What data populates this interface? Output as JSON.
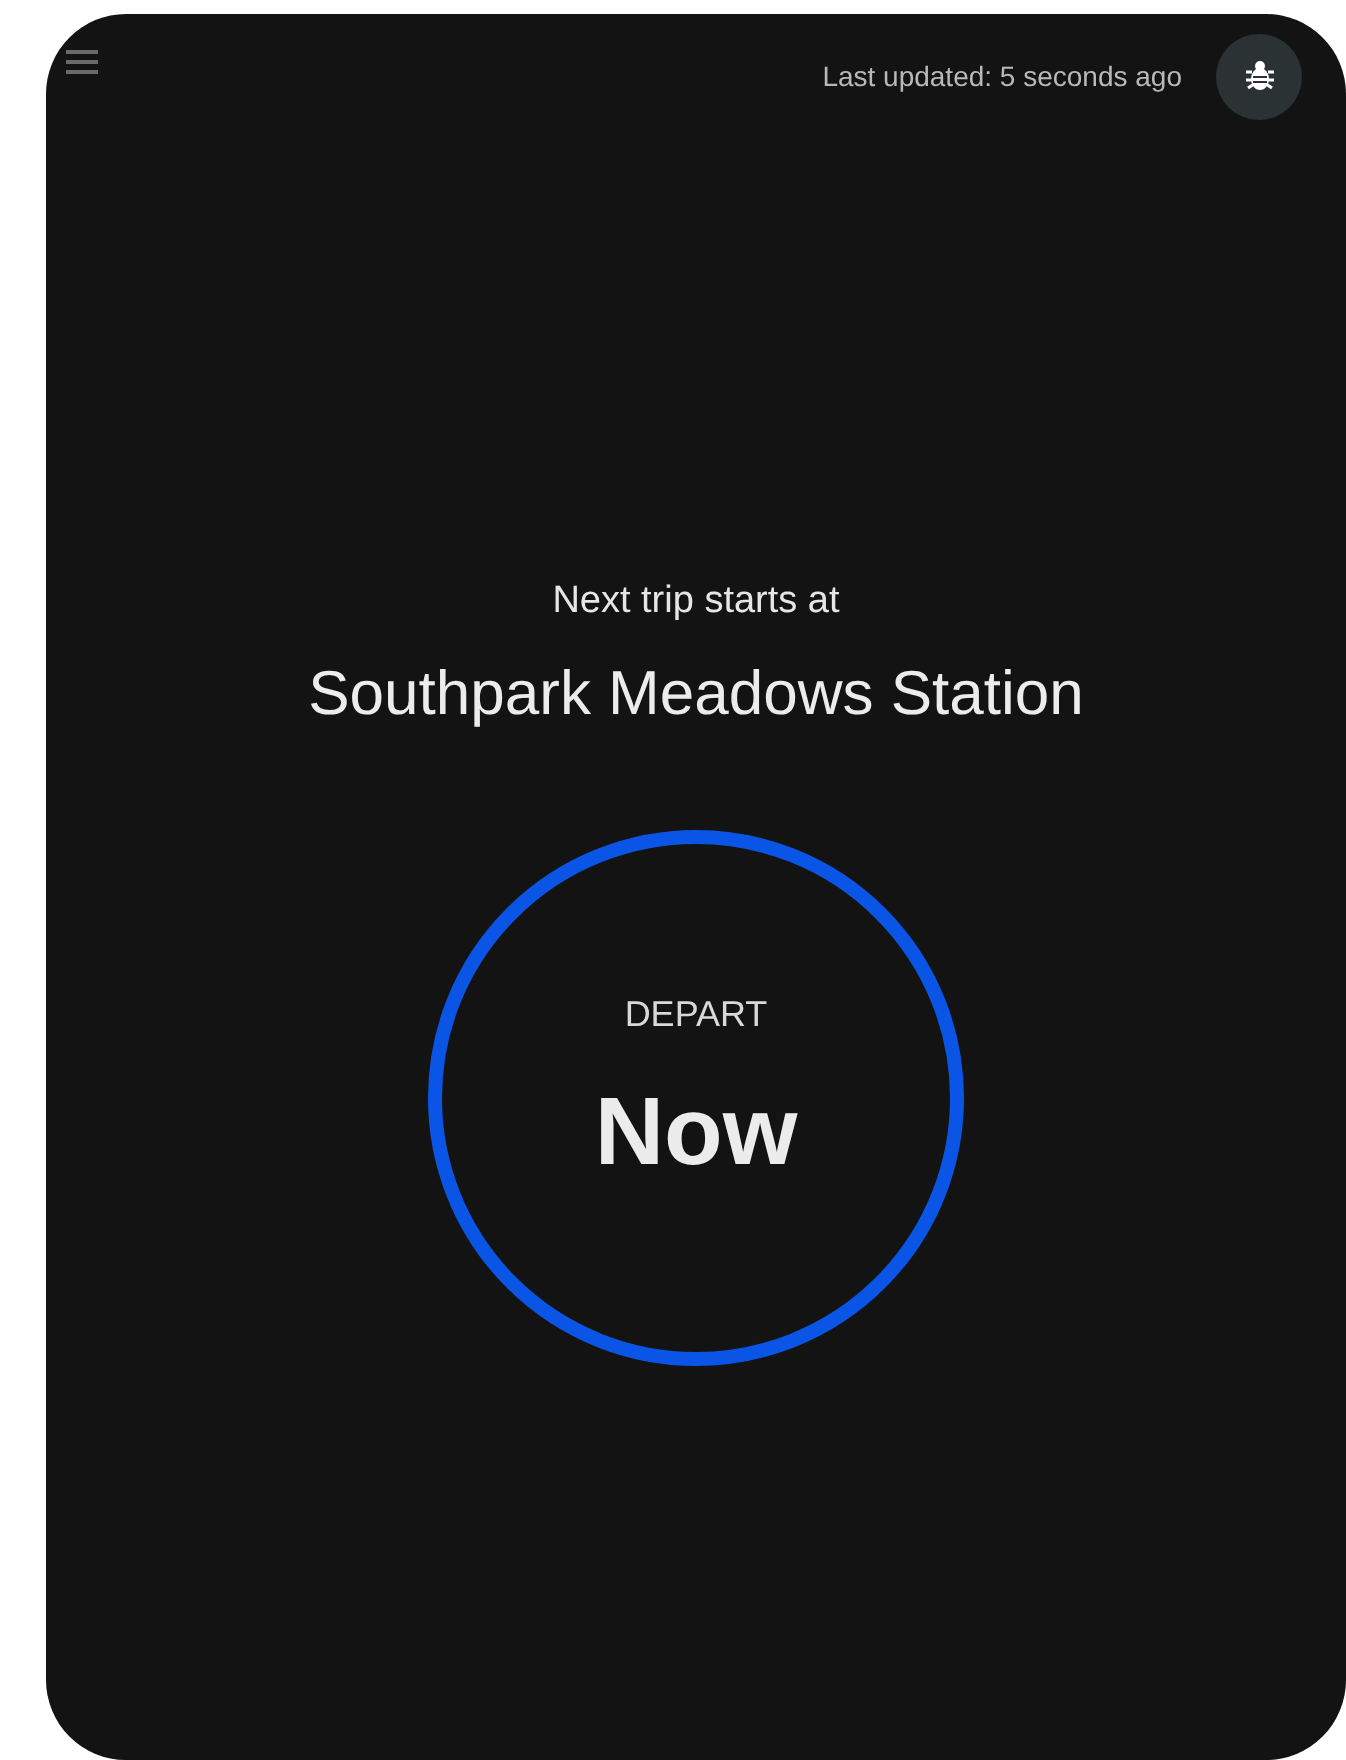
{
  "header": {
    "last_updated": "Last updated: 5 seconds ago"
  },
  "trip": {
    "caption": "Next trip starts at",
    "station": "Southpark Meadows Station"
  },
  "departure": {
    "label": "DEPART",
    "time": "Now"
  }
}
